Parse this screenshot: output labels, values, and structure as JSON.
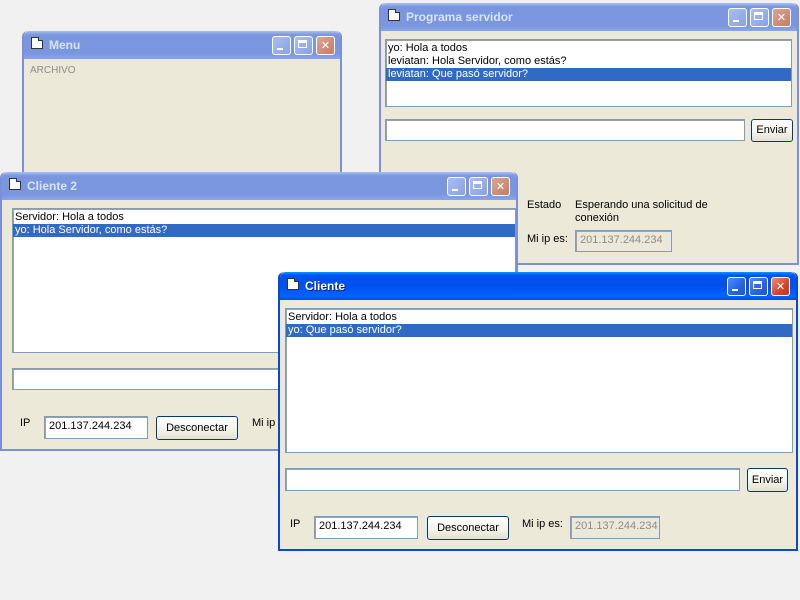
{
  "menu_window": {
    "title": "Menu",
    "menu": {
      "archivo": "ARCHIVO"
    }
  },
  "server_window": {
    "title": "Programa servidor",
    "messages": [
      "yo: Hola a todos",
      "leviatan: Hola Servidor, como estás?",
      "leviatan: Que pasó servidor?"
    ],
    "input_value": "",
    "send_label": "Enviar",
    "estado_label": "Estado",
    "estado_value_line1": "Esperando una solicitud de",
    "estado_value_line2": "conexión",
    "my_ip_label": "Mi ip es:",
    "my_ip_value": "201.137.244.234"
  },
  "client2_window": {
    "title": "Cliente 2",
    "messages": [
      "Servidor: Hola a todos",
      "yo: Hola Servidor, como estás?"
    ],
    "input_value": "",
    "ip_label": "IP",
    "ip_value": "201.137.244.234",
    "disconnect_label": "Desconectar",
    "my_ip_label_partial": "Mi ip e"
  },
  "client_window": {
    "title": "Cliente",
    "messages": [
      "Servidor: Hola a todos",
      "yo: Que pasó servidor?"
    ],
    "input_value": "",
    "send_label": "Enviar",
    "ip_label": "IP",
    "ip_value": "201.137.244.234",
    "disconnect_label": "Desconectar",
    "my_ip_label": "Mi ip es:",
    "my_ip_value": "201.137.244.234"
  },
  "colors": {
    "active_title": "#0053ee",
    "inactive_title": "#7a96df",
    "selection": "#316ac5",
    "window_face": "#ece9d8"
  }
}
